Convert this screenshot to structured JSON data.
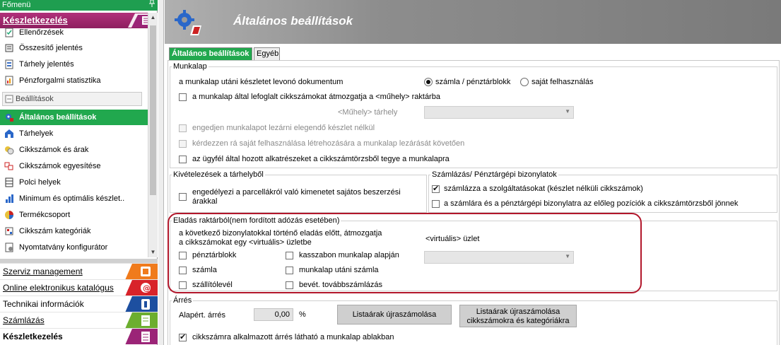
{
  "left_pane": {
    "title": "Főmenü",
    "pin_glyph": "ᵽ",
    "section_header": "Készletkezelés",
    "items": [
      {
        "label": "Ellenőrzések",
        "icon": "check-doc-icon"
      },
      {
        "label": "Összesítő jelentés",
        "icon": "summary-report-icon"
      },
      {
        "label": "Tárhely jelentés",
        "icon": "storage-report-icon"
      },
      {
        "label": "Pénzforgalmi statisztika",
        "icon": "cashflow-stats-icon"
      },
      {
        "label": "Beállítások",
        "icon": "settings-group-icon",
        "group": true
      },
      {
        "label": "Általános beállítások",
        "icon": "general-settings-icon",
        "selected": true
      },
      {
        "label": "Tárhelyek",
        "icon": "storage-location-icon"
      },
      {
        "label": "Cikkszámok és árak",
        "icon": "part-numbers-prices-icon"
      },
      {
        "label": "Cikkszámok egyesítése",
        "icon": "merge-part-numbers-icon"
      },
      {
        "label": "Polci helyek",
        "icon": "shelf-locations-icon"
      },
      {
        "label": "Minimum és optimális készlet..",
        "icon": "min-opt-stock-icon"
      },
      {
        "label": "Termékcsoport",
        "icon": "product-group-icon"
      },
      {
        "label": "Cikkszám kategóriák",
        "icon": "part-category-icon"
      },
      {
        "label": "Nyomtatvány konfigurátor",
        "icon": "form-config-icon"
      }
    ],
    "nav": [
      {
        "label": "Szerviz management",
        "u_index": 0,
        "color": "#f07b1c"
      },
      {
        "label": "Online elektronikus katalógus",
        "u_index": 0,
        "color": "#d8232a"
      },
      {
        "label": "Technikai információk",
        "u_index": 0,
        "color": "#1d4fa0"
      },
      {
        "label": "Számlázás",
        "u_index": 0,
        "color": "#6cae2f"
      },
      {
        "label": "Készletkezelés",
        "u_index": 0,
        "color": "#9b2477"
      }
    ]
  },
  "main": {
    "title": "Általános beállítások",
    "tabs": [
      "Általános beállítások",
      "Egyéb"
    ],
    "munkalap": {
      "title": "Munkalap",
      "doc_label": "a munkalap utáni készletet levonó dokumentum",
      "radio_invoice": "számla / pénztárblokk",
      "radio_own": "saját felhasználás",
      "cb_move": "a munkalap által lefoglalt cikkszámokat átmozgatja a <műhely> raktárba",
      "workshop_label": "<Műhely> tárhely",
      "cb_allow_close": "engedjen munkalapot lezárni elegendő készlet nélkül",
      "cb_ask_own": "kérdezzen rá saját felhasználása létrehozására a munkalap lezárását követően",
      "cb_customer_parts": "az ügyfél által hozott alkatrészeket a cikkszámtörzsből tegye a munkalapra"
    },
    "kivetelezes": {
      "title": "Kivételezések a tárhelyből",
      "cb_parcel": "engedélyezi a parcellákról való kimenetet sajátos beszerzési árakkal"
    },
    "szamlazas": {
      "title": "Számlázás/ Pénztárgépi bizonylatok",
      "cb_services": "számlázza a szolgáltatásokat (készlet nélküli cikkszámok)",
      "cb_advance": "a számlára és a pénztárgépi bizonylatra az előleg pozíciók a cikkszámtörzsből jönnek"
    },
    "eladas": {
      "title": "Eladás raktárból(nem fordított adózás esetében)",
      "desc_line1": "a következő bizonylatokkal történő eladás előtt, átmozgatja",
      "desc_line2": "a cikkszámokat egy <virtuális> üzletbe",
      "virtual_label": "<virtuális> üzlet",
      "cbs": [
        "pénztárblokk",
        "számla",
        "szállítólevél",
        "kasszabon munkalap alapján",
        "munkalap utáni számla",
        "bevét. továbbszámlázás"
      ]
    },
    "arres": {
      "title": "Árrés",
      "default_label": "Alapért. árrés",
      "default_value": "0,00",
      "unit": "%",
      "btn_recalc": "Listaárak újraszámolása",
      "btn_recalc_cat_1": "Listaárak újraszámolása",
      "btn_recalc_cat_2": "cikkszámokra és kategóriákra",
      "cb_visible": "cikkszámra alkalmazott árrés látható a munkalap ablakban"
    }
  }
}
